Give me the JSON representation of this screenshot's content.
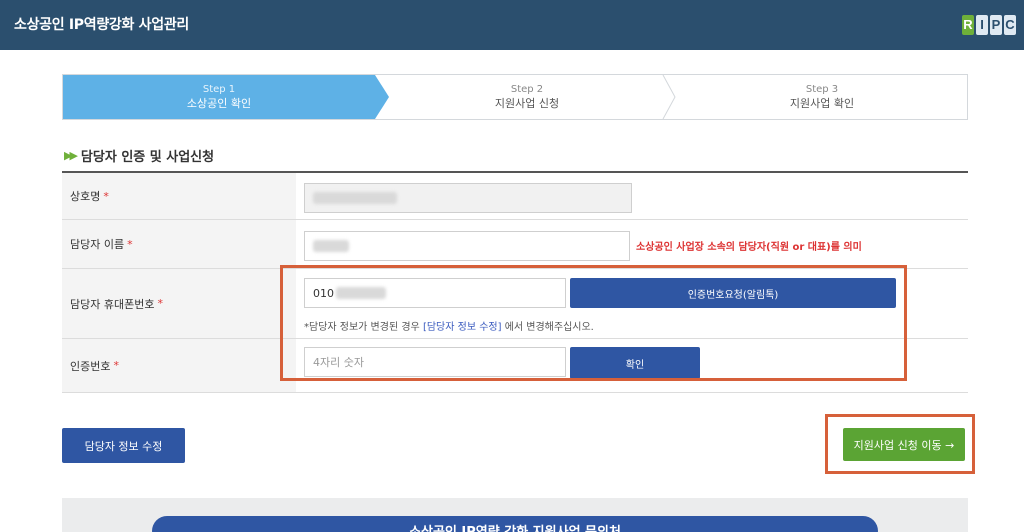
{
  "header": {
    "title": "소상공인 IP역량강화 사업관리",
    "logo_letters": [
      "R",
      "I",
      "P",
      "C"
    ]
  },
  "stepper": {
    "steps": [
      {
        "no": "Step 1",
        "label": "소상공인 확인"
      },
      {
        "no": "Step 2",
        "label": "지원사업 신청"
      },
      {
        "no": "Step 3",
        "label": "지원사업 확인"
      }
    ],
    "active_index": 0,
    "active_color": "#5eb1e6"
  },
  "section": {
    "title": "담당자 인증 및 사업신청",
    "icon": "double-chevron-right-icon"
  },
  "form": {
    "company_label": "상호명",
    "manager_name_label": "담당자 이름",
    "manager_name_note": "소상공인 사업장 소속의 담당자(직원 or 대표)를 의미",
    "phone_label": "담당자 휴대폰번호",
    "phone_prefix": "010",
    "request_code_button": "인증번호요청(알림톡)",
    "phone_note_prefix": "*담당자 정보가 변경된 경우",
    "phone_note_link": "[담당자 정보 수정]",
    "phone_note_suffix": "에서 변경해주십시오.",
    "code_label": "인증번호",
    "code_placeholder": "4자리 숫자",
    "confirm_button": "확인",
    "required_mark": "*"
  },
  "buttons": {
    "edit_manager": "담당자 정보 수정",
    "go_apply": "지원사업 신청 이동 →"
  },
  "contact": {
    "banner": "소상공인 IP역량 강화 지원사업 문의처"
  },
  "colors": {
    "header_bg": "#2b4f6e",
    "primary_blue": "#2f56a3",
    "green": "#5ba434",
    "highlight": "#d6603a",
    "required": "#d33"
  }
}
